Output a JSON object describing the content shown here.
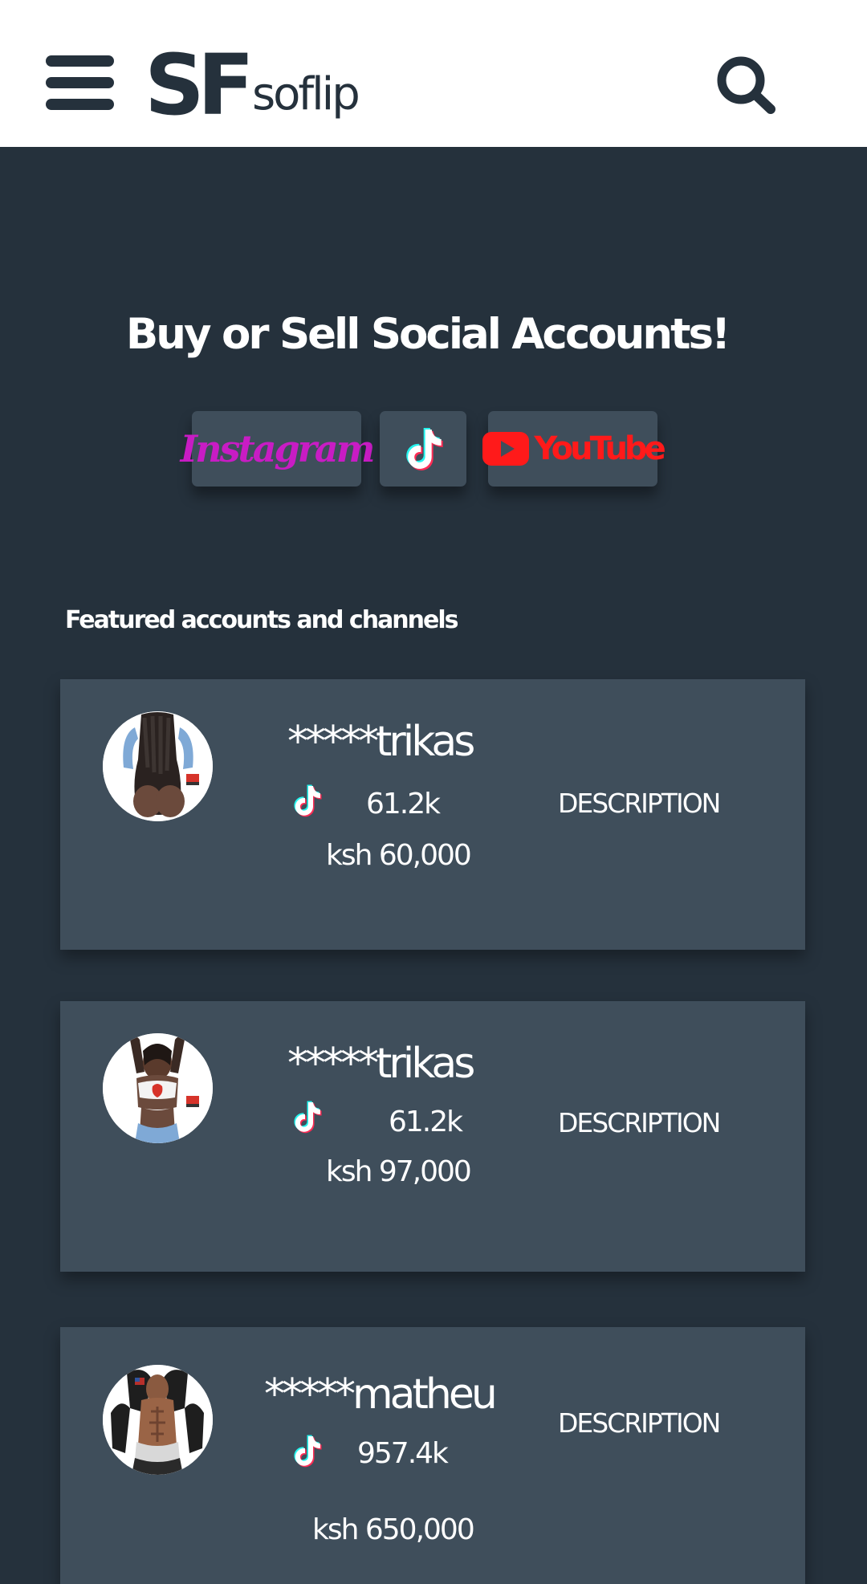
{
  "header": {
    "logo_mark": "SF",
    "logo_text": "soflip",
    "menu_icon": "hamburger-menu-icon",
    "search_icon": "search-icon"
  },
  "hero": {
    "title": "Buy or Sell Social Accounts!",
    "platforms": [
      {
        "label": "Instagram",
        "icon": "instagram-wordmark"
      },
      {
        "label": "",
        "icon": "tiktok-icon"
      },
      {
        "label": "YouTube",
        "icon": "youtube-logo"
      }
    ]
  },
  "featured": {
    "title": "Featured accounts and channels",
    "accounts": [
      {
        "name": "*****trikas",
        "platform_icon": "tiktok-icon",
        "followers": "61.2k",
        "price": "ksh 60,000",
        "description_label": "DESCRIPTION"
      },
      {
        "name": "*****trikas",
        "platform_icon": "tiktok-icon",
        "followers": "61.2k",
        "price": "ksh 97,000",
        "description_label": "DESCRIPTION"
      },
      {
        "name": "*****matheu",
        "platform_icon": "tiktok-icon",
        "followers": "957.4k",
        "price": "ksh 650,000",
        "description_label": "DESCRIPTION"
      }
    ]
  },
  "colors": {
    "background": "#25313c",
    "card": "#3f4e5b",
    "header": "#ffffff",
    "brand_dark": "#25313c",
    "instagram": "#c81cc4",
    "youtube": "#ff1a1a",
    "tiktok_cyan": "#25f4ee",
    "tiktok_pink": "#fe2c55"
  }
}
